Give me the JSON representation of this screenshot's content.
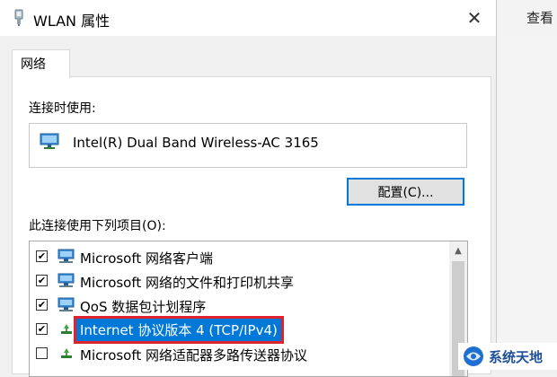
{
  "dialog": {
    "title": "WLAN 属性",
    "close_symbol": "✕"
  },
  "background": {
    "right_text": "查看"
  },
  "tabs": [
    {
      "label": "网络"
    }
  ],
  "network_tab": {
    "connect_using_label": "连接时使用:",
    "adapter_name": "Intel(R) Dual Band Wireless-AC 3165",
    "configure_button": "配置(C)...",
    "items_label": "此连接使用下列项目(O):",
    "items": [
      {
        "label": "Microsoft 网络客户端",
        "checked": true,
        "icon": "network-client-icon"
      },
      {
        "label": "Microsoft 网络的文件和打印机共享",
        "checked": true,
        "icon": "file-printer-sharing-icon"
      },
      {
        "label": "QoS 数据包计划程序",
        "checked": true,
        "icon": "qos-icon"
      },
      {
        "label": "Internet 协议版本 4 (TCP/IPv4)",
        "checked": true,
        "selected": true,
        "icon": "protocol-icon"
      },
      {
        "label": "Microsoft 网络适配器多路传送器协议",
        "checked": false,
        "icon": "protocol-icon"
      }
    ]
  },
  "watermark": {
    "text": "系统天地"
  },
  "colors": {
    "selection": "#0078d7",
    "highlight_box": "#e0222c",
    "watermark": "#1e4f9c"
  }
}
